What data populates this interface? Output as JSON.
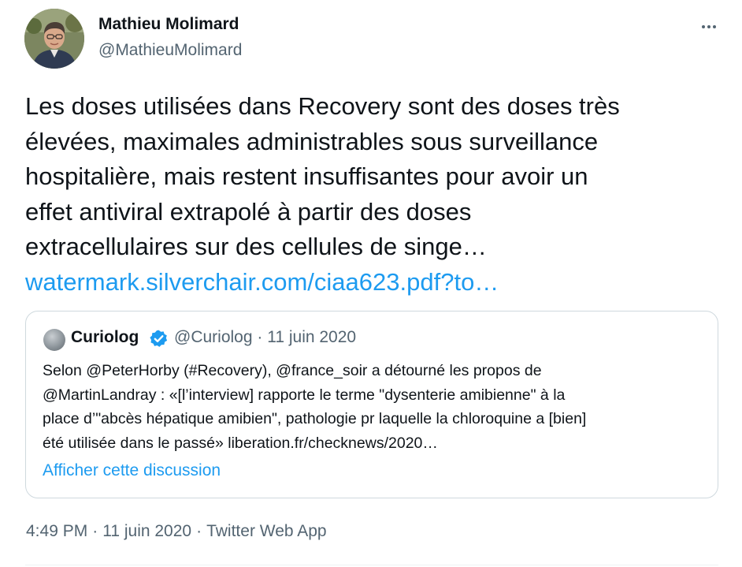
{
  "author": {
    "name": "Mathieu Molimard",
    "handle": "@MathieuMolimard",
    "avatar_icon": "profile-photo"
  },
  "more_icon": "ellipsis-icon",
  "tweet": {
    "lines": [
      "Les doses utilisées dans Recovery sont des doses très",
      "élevées, maximales administrables sous surveillance",
      "hospitalière, mais restent insuffisantes pour avoir un",
      "effet antiviral extrapolé à partir des doses",
      "extracellulaires sur des cellules de singe…"
    ],
    "link": "watermark.silverchair.com/ciaa623.pdf?to…"
  },
  "quote": {
    "name": "Curiolog",
    "verified_icon": "verified-badge-icon",
    "handle": "@Curiolog",
    "date_separator": "·",
    "date": "11 juin 2020",
    "lines": [
      "Selon @PeterHorby (#Recovery), @france_soir a détourné les propos de",
      "@MartinLandray : «[l’interview] rapporte le terme \"dysenterie amibienne\" à la",
      "place d’\"abcès hépatique amibien\", pathologie pr laquelle la chloroquine a [bien]",
      "été utilisée dans le passé» liberation.fr/checknews/2020…"
    ],
    "show_thread": "Afficher cette discussion"
  },
  "footer": {
    "time": "4:49 PM",
    "separator": "·",
    "date": "11 juin 2020",
    "source": "Twitter Web App"
  },
  "colors": {
    "link": "#1d9bf0",
    "secondary_text": "#536471",
    "primary_text": "#0f1419",
    "border": "#cfd9de"
  }
}
